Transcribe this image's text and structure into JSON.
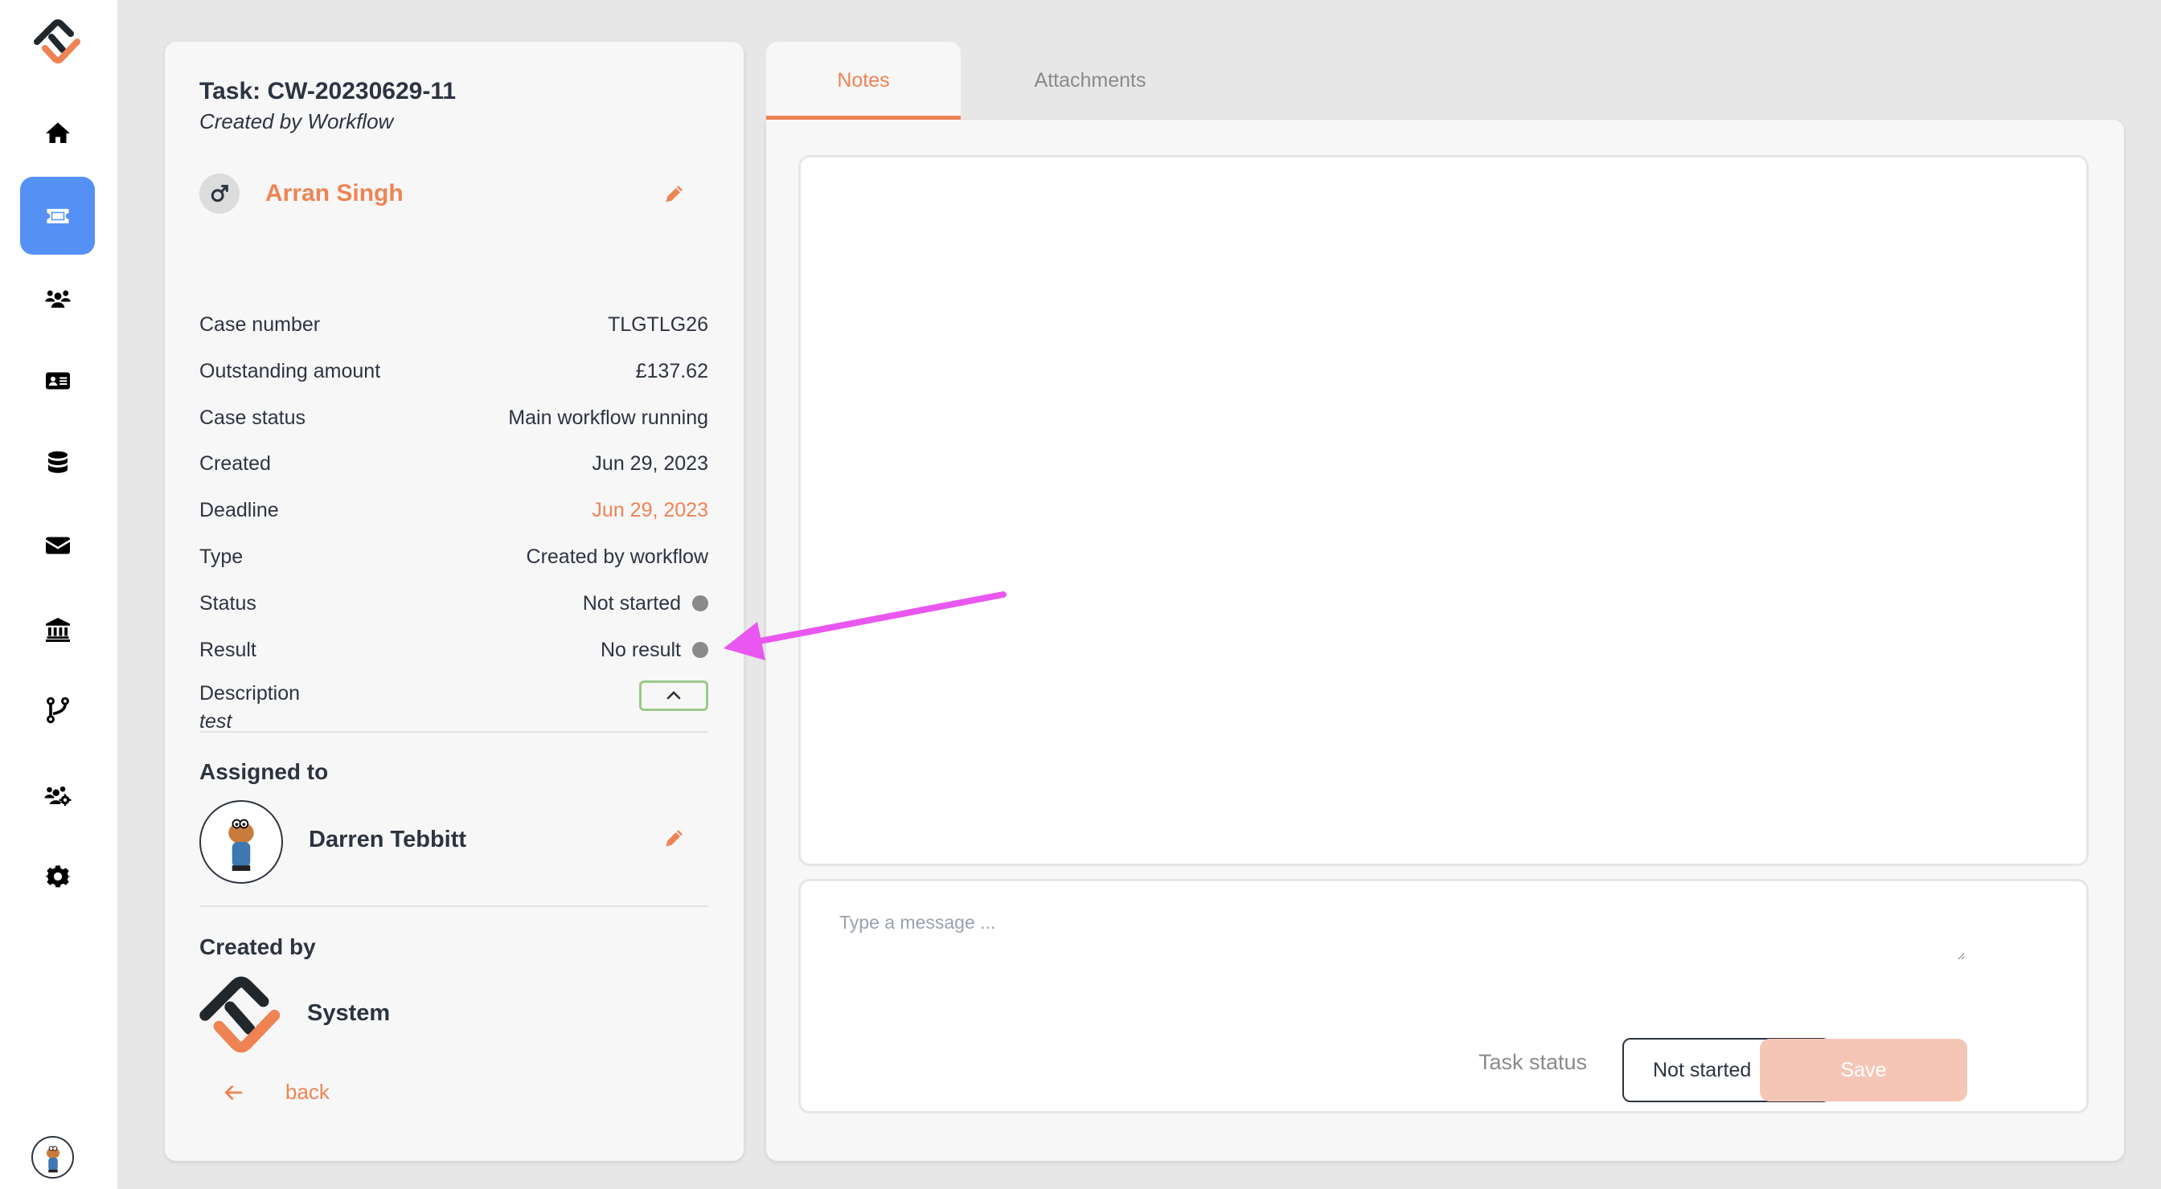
{
  "sidebar": {
    "logo": "company-logo",
    "items": [
      {
        "id": "home",
        "icon": "home-icon",
        "active": false
      },
      {
        "id": "tasks",
        "icon": "ticket-icon",
        "active": true
      },
      {
        "id": "customers",
        "icon": "users-icon",
        "active": false
      },
      {
        "id": "contacts",
        "icon": "id-card-icon",
        "active": false
      },
      {
        "id": "data",
        "icon": "database-icon",
        "active": false
      },
      {
        "id": "messages",
        "icon": "mail-icon",
        "active": false
      },
      {
        "id": "bank",
        "icon": "bank-icon",
        "active": false
      },
      {
        "id": "workflows",
        "icon": "branch-icon",
        "active": false
      },
      {
        "id": "teams",
        "icon": "users-gear-icon",
        "active": false
      },
      {
        "id": "settings",
        "icon": "gear-icon",
        "active": false
      }
    ],
    "user_avatar": "user-avatar"
  },
  "task": {
    "title": "Task: CW-20230629-11",
    "subtitle": "Created by Workflow",
    "customer": {
      "name": "Arran Singh",
      "gender_icon": "male-icon"
    },
    "details": [
      {
        "label": "Case number",
        "value": "TLGTLG26"
      },
      {
        "label": "Outstanding amount",
        "value": "£137.62"
      },
      {
        "label": "Case status",
        "value": "Main workflow running"
      },
      {
        "label": "Created",
        "value": "Jun 29, 2023"
      },
      {
        "label": "Deadline",
        "value": "Jun 29, 2023",
        "highlight": "#ef8354"
      },
      {
        "label": "Type",
        "value": "Created by workflow"
      },
      {
        "label": "Status",
        "value": "Not started",
        "dot_color": "#8a8a8a"
      },
      {
        "label": "Result",
        "value": "No result",
        "dot_color": "#8a8a8a"
      }
    ],
    "description": {
      "label": "Description",
      "text": "test",
      "toggle_icon": "chevron-up-icon"
    },
    "assigned_to": {
      "heading": "Assigned to",
      "name": "Darren Tebbitt"
    },
    "created_by": {
      "heading": "Created by",
      "name": "System"
    },
    "back_label": "back"
  },
  "tabs": [
    {
      "label": "Notes",
      "active": true
    },
    {
      "label": "Attachments",
      "active": false
    }
  ],
  "composer": {
    "placeholder": "Type a message ...",
    "value": "",
    "task_status_label": "Task status",
    "task_status_value": "Not started",
    "save_label": "Save"
  },
  "colors": {
    "accent": "#ef8354",
    "active_nav": "#5591f5",
    "annotation_arrow": "#e957f0",
    "focus_border": "#9bc88a",
    "save_disabled": "#f5c6b6"
  }
}
